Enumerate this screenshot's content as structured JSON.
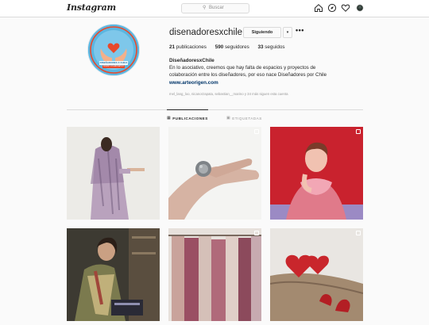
{
  "nav": {
    "logo": "Instagram",
    "search_placeholder": "Buscar",
    "icons": [
      "search-icon",
      "home-icon",
      "explore-icon",
      "heart-icon",
      "profile-avatar"
    ]
  },
  "profile": {
    "username": "disenadoresxchile",
    "follow_button": "Siguiendo",
    "caret": "▾",
    "more": "•••",
    "stats": {
      "posts_value": "21",
      "posts_label": "publicaciones",
      "followers_value": "590",
      "followers_label": "seguidores",
      "following_value": "33",
      "following_label": "seguidos"
    },
    "full_name": "DiseñadoresxChile",
    "bio": "En lo asociativo, creemos que hay falta de espacios y proyectos de colaboración entre los diseñadores, por eso nace Diseñadores por Chile",
    "link": "www.arteorigen.com",
    "followed_by": "mel_lang_loo, nicanorzapata, sebastian__marino y 34 más siguen esta cuenta",
    "avatar_text_line1": "DISEÑADORES X CHILE",
    "avatar_text_line2": "DISEÑO COLABORATIVO"
  },
  "tabs": [
    {
      "label": "PUBLICACIONES",
      "active": true,
      "icon": "grid-icon"
    },
    {
      "label": "ETIQUETADAS",
      "active": false,
      "icon": "tag-icon"
    }
  ],
  "posts": [
    {
      "subject": "tie-dye-kimono",
      "multi": false
    },
    {
      "subject": "silver-ring-hand",
      "multi": true
    },
    {
      "subject": "red-jacket-portrait",
      "multi": true
    },
    {
      "subject": "woman-knitting",
      "multi": false
    },
    {
      "subject": "knitwear-rack",
      "multi": true
    },
    {
      "subject": "heart-earrings",
      "multi": true
    }
  ],
  "colors": {
    "accent_link": "#003569",
    "border": "#dbdbdb",
    "background": "#fafafa",
    "avatar_blue": "#5bb6e0",
    "avatar_ring": "#e8492b"
  }
}
